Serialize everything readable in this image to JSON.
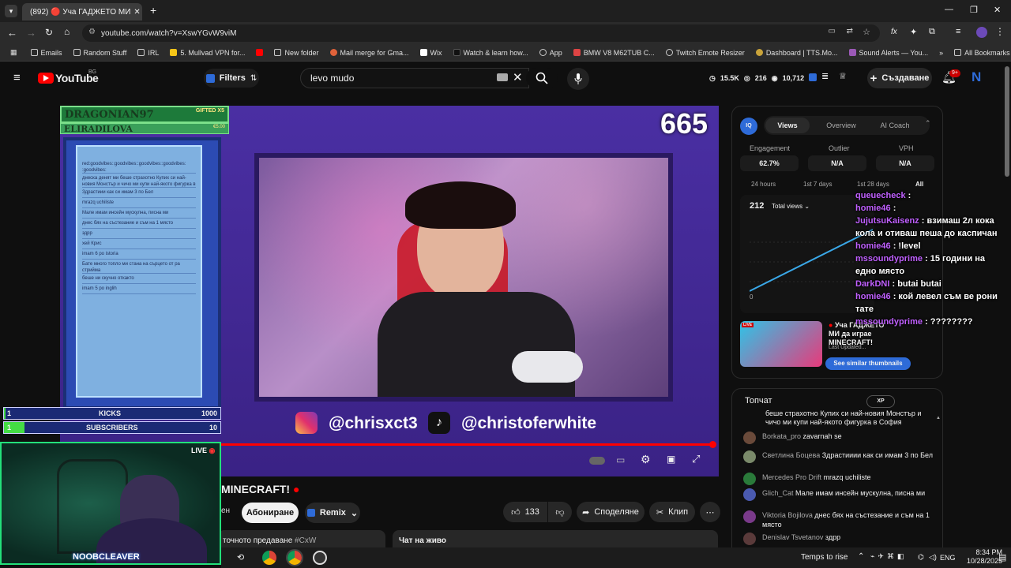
{
  "browser": {
    "tab_title": "(892) 🔴 Уча ГАДЖЕТО МИ",
    "url": "youtube.com/watch?v=XswYGvW9viM",
    "bookmarks": [
      "Emails",
      "Random Stuff",
      "IRL",
      "5. Mullvad VPN for...",
      "New folder",
      "Mail merge for Gma...",
      "Wix",
      "Watch & learn how...",
      "App",
      "BMW V8 M62TUB C...",
      "Twitch Emote Resizer",
      "Dashboard | TTS.Mo...",
      "Sound Alerts — You..."
    ],
    "all_bookmarks": "All Bookmarks"
  },
  "youtube": {
    "logo": "YouTube",
    "region": "BG",
    "filters_label": "Filters",
    "search_value": "levo mudo",
    "stats": [
      "15.5K",
      "216",
      "10,712"
    ],
    "create_label": "Създаване",
    "notif_count": "9+",
    "avatar_letter": "N"
  },
  "video": {
    "viewer_counter": "665",
    "overlay_top_name": "DRAGONIAN97",
    "overlay_top_badge": "GIFTED X5",
    "overlay_second_name": "ELIRADILOVA",
    "overlay_second_amount": "€5.00",
    "social_instagram": "@chrisxct3",
    "social_tiktok": "@christoferwhite",
    "goal_kicks_label": "KICKS",
    "goal_kicks_current": "1",
    "goal_kicks_target": "1000",
    "goal_subs_label": "SUBSCRIBERS",
    "goal_subs_current": "1",
    "goal_subs_target": "10",
    "cam_live": "LIVE",
    "cam_name": "NOOBCLEAVER",
    "overlay_chat": [
      "red:goodvibes::goodvibes::goodvibes::goodvibes: :goodvibes:",
      "днеска денят ми беше страхотно Купих си най-новия Монстър и чичо ми купи най-якото фигурка в София",
      "Здрастиии как си имам 3 по Бел",
      "mrazq uchiliste",
      "Мале имам инсейн мускулна, писна ми",
      "днес бях на състезание и съм на 1 място",
      "здрр",
      "хей Крис",
      "imam 6 po istoria",
      "Бате много топло ми стана на сърцето от ра стриймa",
      "беше ни скучно откакто",
      "imam 5 po inglih"
    ]
  },
  "below_video": {
    "title_fragment": "MINECRAFT!",
    "subscribe_label": "Абониране",
    "remix_label": "Remix",
    "likes": "133",
    "share_label": "Споделяне",
    "clip_label": "Клип",
    "desc_fragment": "точното предаване",
    "desc_hashtag": "#CxW",
    "live_chat_btn": "Чат на живо"
  },
  "vidiq": {
    "tabs": [
      "Views",
      "Overview",
      "AI Coach"
    ],
    "metrics": [
      {
        "label": "Engagement",
        "value": "62.7%"
      },
      {
        "label": "Outlier",
        "value": "N/A"
      },
      {
        "label": "VPH",
        "value": "N/A"
      }
    ],
    "ranges": [
      "24 hours",
      "1st 7 days",
      "1st 28 days",
      "All"
    ],
    "views_total": "212",
    "views_select": "Total views",
    "y_zero": "0",
    "related_title": "Уча ГАДЖЕТО МИ да играе MINECRAFT!",
    "related_meta": "Last Updated...",
    "see_similar": "See similar thumbnails"
  },
  "chat_overlay_right": [
    {
      "user": "queuecheck",
      "text": ""
    },
    {
      "user": "homie46",
      "text": ""
    },
    {
      "user": "JujutsuKaisenz",
      "text": "взимаш 2л кока кола и отиваш пеша до каспичан"
    },
    {
      "user": "homie46",
      "text": "!level"
    },
    {
      "user": "mssoundyprime",
      "text": "15 години на едно място"
    },
    {
      "user": "DarkDNI",
      "text": "butai butai"
    },
    {
      "user": "homie46",
      "text": "кой левел съм ве рони тате"
    },
    {
      "user": "mssoundyprime",
      "text": "????????"
    }
  ],
  "live_chat": {
    "title": "Топчат",
    "first_msg": "беше страхотно Купих си най-новия Монстър и чичо ми купи най-якото фигурка в София",
    "messages": [
      {
        "user": "Borkata_pro",
        "text": "zavarnah se",
        "color": "#6a4a3a"
      },
      {
        "user": "Светлина Бoцева",
        "text": "Здрастииии как си имам 3 по Бел",
        "color": "#7a8a6a"
      },
      {
        "user": "Mercedes Pro Drift",
        "text": "mrazq uchiliste",
        "color": "#2a7a3a"
      },
      {
        "user": "Glich_Cat",
        "text": "Мале имам инсейн мускулна, писна ми",
        "color": "#4a5ab0"
      },
      {
        "user": "Viktoria Bojilova",
        "text": "днес бях на състезание и съм на 1 място",
        "color": "#7a3a8a"
      },
      {
        "user": "Denislav Tsvetanov",
        "text": "здрр",
        "color": "#5a3a3a"
      }
    ]
  },
  "taskbar": {
    "weather": "Temps to rise",
    "lang": "ENG",
    "time": "8:34 PM",
    "date": "10/28/2025"
  }
}
